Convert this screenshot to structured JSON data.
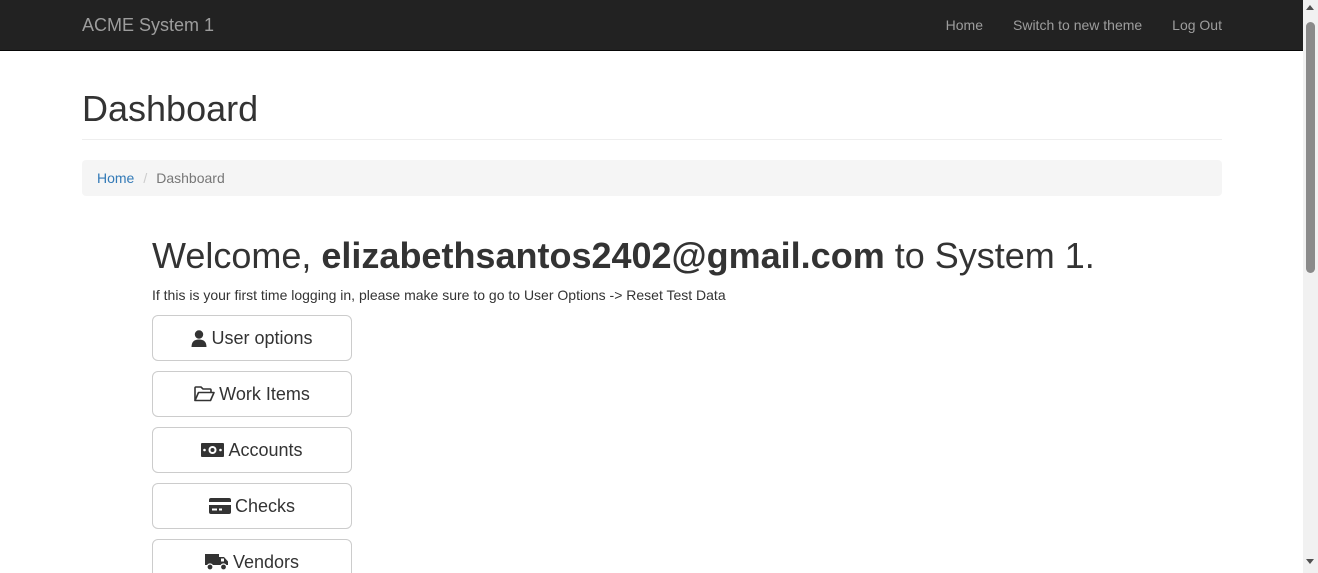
{
  "navbar": {
    "brand": "ACME System 1",
    "links": [
      "Home",
      "Switch to new theme",
      "Log Out"
    ]
  },
  "page": {
    "title": "Dashboard"
  },
  "breadcrumb": {
    "home": "Home",
    "separator": "/",
    "current": "Dashboard"
  },
  "welcome": {
    "prefix": "Welcome, ",
    "email": "elizabethsantos2402@gmail.com",
    "suffix": " to System 1.",
    "hint": "If this is your first time logging in, please make sure to go to User Options -> Reset Test Data"
  },
  "buttons": [
    {
      "label": "User options",
      "icon": "user-icon"
    },
    {
      "label": "Work Items",
      "icon": "folder-open-icon"
    },
    {
      "label": "Accounts",
      "icon": "money-icon"
    },
    {
      "label": "Checks",
      "icon": "credit-card-icon"
    },
    {
      "label": "Vendors",
      "icon": "truck-icon"
    }
  ],
  "colors": {
    "navbar_bg": "#222222",
    "navbar_text": "#9d9d9d",
    "link": "#337ab7",
    "breadcrumb_bg": "#f5f5f5"
  }
}
